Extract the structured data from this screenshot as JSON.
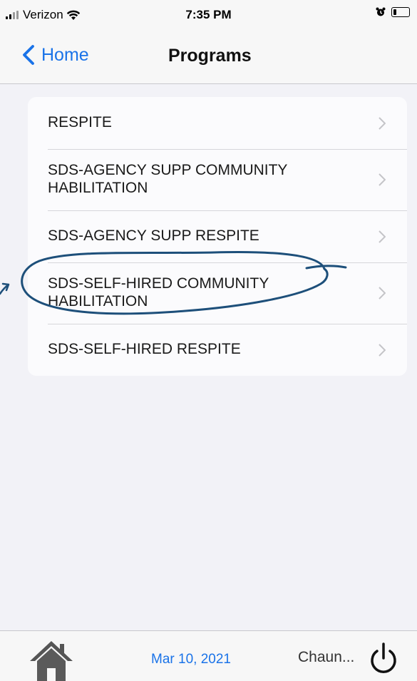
{
  "status_bar": {
    "carrier": "Verizon",
    "time": "7:35 PM",
    "icons": [
      "signal-icon",
      "wifi-icon",
      "alarm-icon",
      "battery-icon"
    ]
  },
  "nav": {
    "back_label": "Home",
    "title": "Programs"
  },
  "programs": [
    {
      "label": "RESPITE"
    },
    {
      "label": "SDS-AGENCY SUPP COMMUNITY\nHABILITATION"
    },
    {
      "label": "SDS-AGENCY SUPP RESPITE"
    },
    {
      "label": "SDS-SELF-HIRED COMMUNITY\nHABILITATION"
    },
    {
      "label": "SDS-SELF-HIRED RESPITE"
    }
  ],
  "toolbar": {
    "home_icon": "home-icon",
    "date": "Mar 10, 2021",
    "user": "Chaun...",
    "power_icon": "power-icon"
  },
  "colors": {
    "accent": "#1a73e8",
    "annotation": "#1d4f7a",
    "background": "#f2f2f7"
  }
}
